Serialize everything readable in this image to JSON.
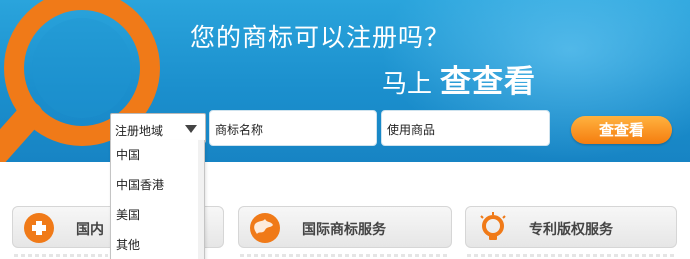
{
  "hero": {
    "headline": "您的商标可以注册吗？",
    "subline_prefix": "马上",
    "subline_emphasis": "查查看"
  },
  "search": {
    "region_select": {
      "selected": "注册地域",
      "options": [
        "中国",
        "中国香港",
        "美国",
        "其他"
      ]
    },
    "trademark_name_placeholder": "商标名称",
    "goods_placeholder": "使用商品",
    "search_button_label": "查查看"
  },
  "services": [
    {
      "label": "国内",
      "icon": "plus-icon"
    },
    {
      "label": "国际商标服务",
      "icon": "globe-icon"
    },
    {
      "label": "专利版权服务",
      "icon": "lightbulb-icon"
    }
  ],
  "colors": {
    "banner_blue": "#1b8fcd",
    "accent_orange": "#f57d0f",
    "card_gray": "#e6e6e6"
  }
}
